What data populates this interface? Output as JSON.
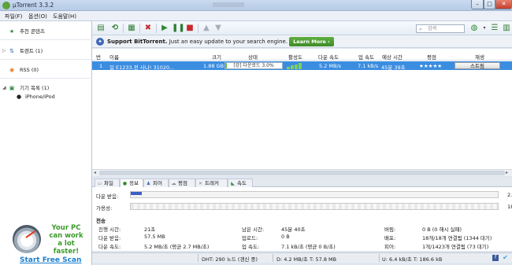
{
  "window": {
    "title": "µTorrent 3.3.2",
    "min": "–",
    "max": "□",
    "close": "✕"
  },
  "menu": [
    "파일(F)",
    "옵션(O)",
    "도움말(H)"
  ],
  "sidebar": {
    "featured": "추천 콘텐츠",
    "torrents": "토렌트 (1)",
    "rss": "RSS (0)",
    "devices": "기기 목록 (1)",
    "device_item": "iPhone/iPod",
    "ad_line1": "Your PC",
    "ad_line2": "can work",
    "ad_line3": "a lot faster!",
    "ad_link": "Start Free Scan"
  },
  "toolbar": {
    "search_placeholder": "검색"
  },
  "banner": {
    "bold": "Support BitTorrent.",
    "text": " Just an easy update to your search engine.",
    "button": "Learn More ›"
  },
  "list": {
    "columns": [
      "번",
      "이름",
      "크기",
      "상태",
      "활성도",
      "다운 속도",
      "업 속도",
      "예상 시간",
      "평점",
      "재생"
    ],
    "row": {
      "num": "1",
      "name": "일  E1233.전  사나!  31020...",
      "size": "1.88 GB",
      "status": "[강] 다운로드 3.0%",
      "progress": 0.03,
      "health_levels": [
        0.4,
        0.6,
        0.8,
        1.0
      ],
      "down": "5.2 MB/s",
      "up": "7.1 kB/s",
      "eta": "45분 39초",
      "rating": "★★★★★",
      "stream": "스트림"
    }
  },
  "tabs": [
    {
      "label": "파일",
      "icon": "file-icon"
    },
    {
      "label": "정보",
      "icon": "info-icon"
    },
    {
      "label": "피어",
      "icon": "peers-icon"
    },
    {
      "label": "평점",
      "icon": "rating-icon"
    },
    {
      "label": "트래커",
      "icon": "tracker-icon"
    },
    {
      "label": "속도",
      "icon": "speed-icon"
    }
  ],
  "info": {
    "downloaded_label": "다운 받음:",
    "downloaded_progress": 0.03,
    "downloaded_value": "2.",
    "availability_label": "가용성:",
    "availability_value": "18",
    "transfer_title": "전송",
    "left": [
      [
        "진행 시간:",
        "21초"
      ],
      [
        "다운 받음:",
        "57.5 MB"
      ],
      [
        "다운 속도:",
        "5.2 MB/초 (평균 2.7 MB/초)"
      ]
    ],
    "mid": [
      [
        "남은 시간:",
        "45분 40초"
      ],
      [
        "업로드:",
        "0 B"
      ],
      [
        "업 속도:",
        "7.1 kB/초 (평균 0 B/초)"
      ]
    ],
    "right": [
      [
        "버림:",
        "0 B (0 해시 실패)"
      ],
      [
        "배포:",
        "18개/18개 연결됨 (1344 대기)"
      ],
      [
        "피어:",
        "1개/1423개 연결됨 (73 대기)"
      ]
    ]
  },
  "status": {
    "dht": "DHT: 290 노드  (갱신 중)",
    "down": "D: 4.2 MB/초 T: 57.8 MB",
    "up": "U: 6.4 kB/초 T: 186.6 kB"
  }
}
